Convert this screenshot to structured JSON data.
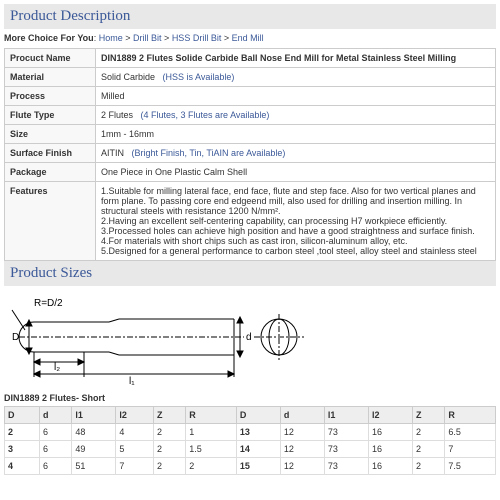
{
  "hdr": {
    "desc": "Product Description",
    "sizes": "Product Sizes"
  },
  "more": {
    "label": "More Choice For You",
    "home": "Home",
    "drill": "Drill Bit",
    "hss": "HSS Drill Bit",
    "end": "End Mill",
    "sep": ">"
  },
  "spec": {
    "name": {
      "k": "Procuct Name",
      "v": "DIN1889 2 Flutes Solide Carbide Ball Nose End Mill for Metal Stainless Steel Milling"
    },
    "mat": {
      "k": "Material",
      "v": "Solid Carbide",
      "a": "(HSS is Available)"
    },
    "proc": {
      "k": "Process",
      "v": "Milled"
    },
    "flute": {
      "k": "Flute Type",
      "v": "2 Flutes",
      "a": "(4 Flutes, 3 Flutes are Available)"
    },
    "size": {
      "k": "Size",
      "v": "1mm - 16mm"
    },
    "finish": {
      "k": "Surface Finish",
      "v": "AITIN",
      "a": "(Bright Finish, Tin, TiAIN are Available)"
    },
    "pkg": {
      "k": "Package",
      "v": "One Piece in One Plastic Calm Shell"
    },
    "feat": {
      "k": "Features",
      "v1": "1.Suitable for milling lateral face, end face, flute and step face. Also for two vertical planes and form plane. To passing core end edgeend mill, also used for drilling and insertion milling. In structural steels with resistance 1200 N/mm².",
      "v2": "2.Having an excellent self-centering capability, can processing H7 workpiece efficiently.",
      "v3": "3.Processed holes can achieve high position and have a good straightness and surface finish.",
      "v4": "4.For materials with short chips such as cast iron, silicon-aluminum alloy, etc.",
      "v5": "5.Designed for a general performance to carbon steel ,tool steel, alloy steel and stainless steel"
    }
  },
  "diag": {
    "r": "R=D/2",
    "D": "D",
    "d": "d",
    "l1": "l₁",
    "l2": "l₂"
  },
  "tbl": {
    "caption": "DIN1889 2 Flutes- Short",
    "h": [
      "D",
      "d",
      "l1",
      "l2",
      "Z",
      "R",
      "D",
      "d",
      "l1",
      "l2",
      "Z",
      "R"
    ],
    "r": [
      [
        "2",
        "6",
        "48",
        "4",
        "2",
        "1",
        "13",
        "12",
        "73",
        "16",
        "2",
        "6.5"
      ],
      [
        "3",
        "6",
        "49",
        "5",
        "2",
        "1.5",
        "14",
        "12",
        "73",
        "16",
        "2",
        "7"
      ],
      [
        "4",
        "6",
        "51",
        "7",
        "2",
        "2",
        "15",
        "12",
        "73",
        "16",
        "2",
        "7.5"
      ]
    ]
  }
}
